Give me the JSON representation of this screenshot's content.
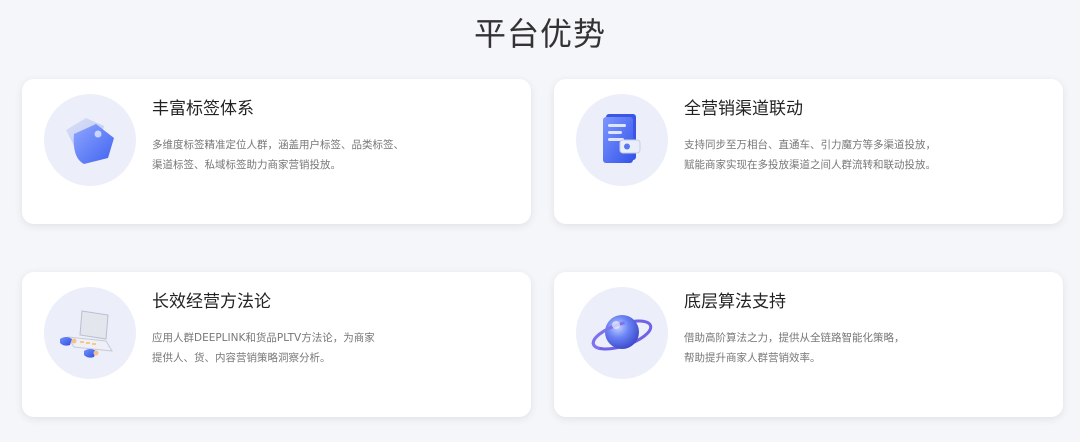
{
  "page": {
    "title": "平台优势"
  },
  "cards": [
    {
      "icon": "tag-icon",
      "title": "丰富标签体系",
      "desc": [
        "多维度标签精准定位人群，涵盖用户标签、品类标签、",
        "渠道标签、私域标签助力商家营销投放。"
      ]
    },
    {
      "icon": "document-card-icon",
      "title": "全营销渠道联动",
      "desc": [
        "支持同步至万相台、直通车、引力魔方等多渠道投放，",
        "赋能商家实现在多投放渠道之间人群流转和联动投放。"
      ]
    },
    {
      "icon": "laptop-icon",
      "title": "长效经营方法论",
      "desc": [
        "应用人群DEEPLINK和货品PLTV方法论，为商家",
        "提供人、货、内容营销策略洞察分析。"
      ]
    },
    {
      "icon": "orbit-sphere-icon",
      "title": "底层算法支持",
      "desc": [
        "借助高阶算法之力，提供从全链路智能化策略，",
        "帮助提升商家人群营销效率。"
      ]
    }
  ],
  "colors": {
    "accent": "#4f6ef7",
    "icon_bg": "#eceff9",
    "page_bg": "#f5f6f9"
  }
}
